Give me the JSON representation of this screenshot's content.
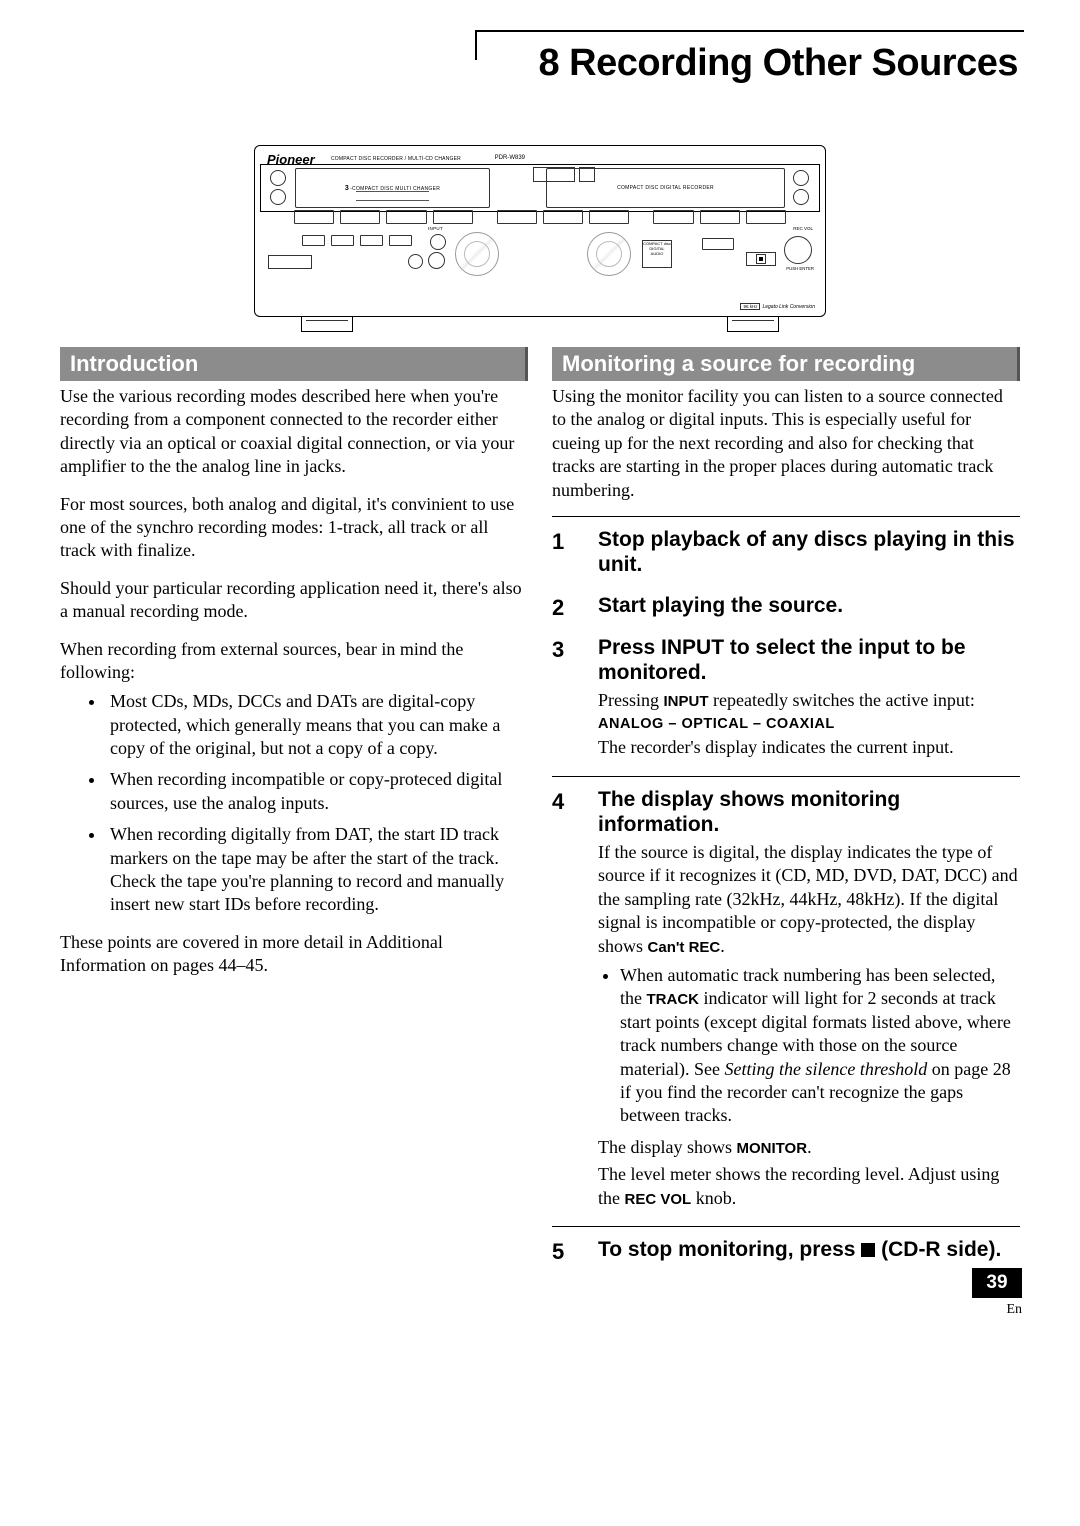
{
  "chapter": {
    "number": "8",
    "title": "Recording Other Sources"
  },
  "device": {
    "brand": "Pioneer",
    "subtitle": "COMPACT DISC RECORDER / MULTI-CD CHANGER",
    "model": "PDR-W839",
    "left_drawer_three": "3",
    "left_drawer_label": "-COMPACT DISC MULTI CHANGER",
    "right_drawer_label": "COMPACT DISC DIGITAL RECORDER",
    "input_label": "INPUT",
    "dd_logo": "COMPACT disc DIGITAL AUDIO",
    "rec_vol": "REC VOL",
    "push_enter": "PUSH ENTER",
    "legato_box": "96 kHz",
    "legato": "Legato Link Conversion"
  },
  "intro": {
    "heading": "Introduction",
    "p1": "Use the various recording modes described here when you're recording from a component connected to the recorder either directly via an optical or coaxial digital connection, or via your amplifier to the the analog line in jacks.",
    "p2": "For most sources, both analog and digital, it's convinient to use one of the synchro recording modes: 1-track, all track or all track with finalize.",
    "p3": "Should your particular recording application need it, there's also a manual recording mode.",
    "p4": "When recording from external sources, bear in mind the following:",
    "bullets": [
      "Most CDs, MDs, DCCs and DATs are digital-copy protected, which generally means that you can make a copy of the original, but not a copy of a copy.",
      "When recording incompatible or copy-proteced digital sources, use the analog inputs.",
      "When recording digitally from DAT, the start ID track markers on the tape may be after the start of the track. Check the tape you're planning to record and manually insert new start IDs before recording."
    ],
    "p5": "These points are covered in more detail in Additional Information on pages 44–45."
  },
  "monitor": {
    "heading": "Monitoring a source for recording",
    "intro": "Using the monitor facility you can listen to a source connected to the analog or digital inputs. This is especially useful for cueing up for the next recording and also for checking that tracks are starting in the proper places during automatic track numbering.",
    "steps": {
      "s1": {
        "num": "1",
        "title": "Stop playback of any discs playing in this unit."
      },
      "s2": {
        "num": "2",
        "title": "Start playing the source."
      },
      "s3": {
        "num": "3",
        "title": "Press INPUT to select the input to be monitored.",
        "line1a": "Pressing ",
        "line1b": "INPUT",
        "line1c": " repeatedly switches the active input:",
        "modes": "ANALOG – OPTICAL – COAXIAL",
        "line2": "The recorder's display indicates the current input."
      },
      "s4": {
        "num": "4",
        "title": "The display shows monitoring information.",
        "p1a": "If the source is digital, the display indicates the type of source if it recognizes it (CD, MD, DVD, DAT, DCC) and the sampling rate (32kHz, 44kHz, 48kHz). If the digital signal is incompatible or copy-protected, the display shows ",
        "p1b": "Can't REC",
        "p1c": ".",
        "bullet_a": "When automatic track numbering has been selected, the ",
        "bullet_b": "TRACK",
        "bullet_c": " indicator will light for 2 seconds at track start points (except digital formats listed above, where track numbers change with those on the source material). See ",
        "bullet_i": "Setting the silence threshold",
        "bullet_d": " on page 28 if you find the recorder can't recognize the gaps between tracks.",
        "show_a": "The display shows ",
        "show_b": "MONITOR",
        "show_c": ".",
        "level_a": "The level meter shows the recording level. Adjust using the ",
        "level_b": "REC VOL",
        "level_c": " knob."
      },
      "s5": {
        "num": "5",
        "title_a": "To stop monitoring, press ",
        "title_b": " (CD-R side)."
      }
    }
  },
  "page": {
    "number": "39",
    "lang": "En"
  }
}
